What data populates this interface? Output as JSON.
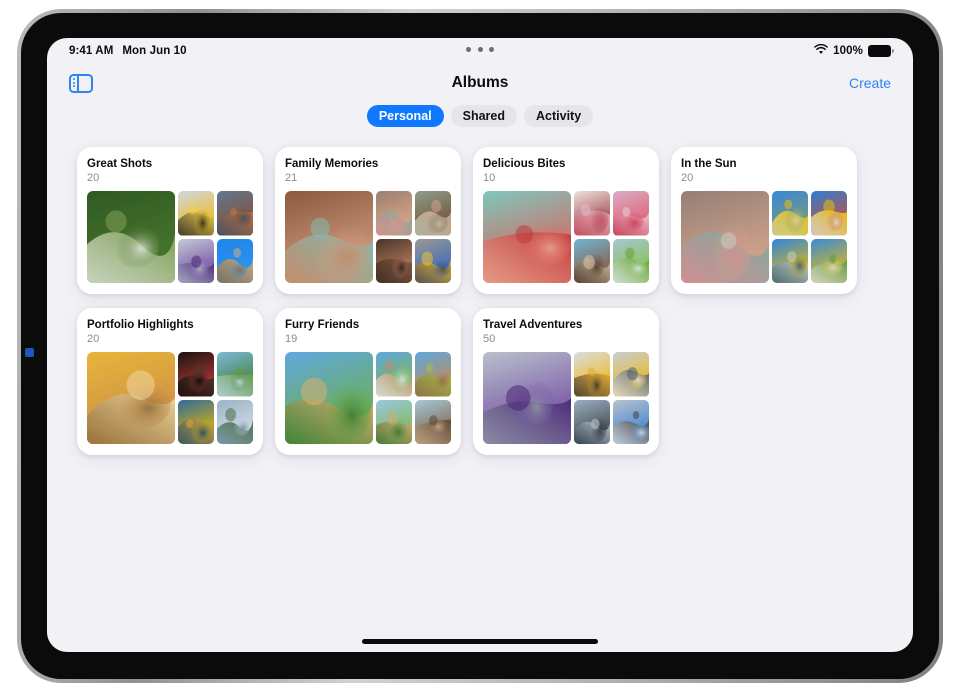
{
  "status_bar": {
    "time": "9:41 AM",
    "date": "Mon Jun 10",
    "battery_percent": "100%",
    "wifi_icon": "wifi-icon",
    "battery_icon": "battery-full-icon",
    "camera_dots_icon": "multitasking-dots-icon"
  },
  "nav_bar": {
    "sidebar_toggle_icon": "sidebar-toggle-icon",
    "title": "Albums",
    "create_label": "Create"
  },
  "tabs": [
    {
      "label": "Personal",
      "selected": true
    },
    {
      "label": "Shared",
      "selected": false
    },
    {
      "label": "Activity",
      "selected": false
    }
  ],
  "colors": {
    "accent_blue": "#2f83f7",
    "tab_selected_blue": "#1078ff",
    "screen_background": "#f2f1f6",
    "card_background": "#ffffff",
    "count_text": "#8a8a90"
  },
  "albums": [
    {
      "title": "Great Shots",
      "count": "20",
      "thumbnails": {
        "main": {
          "name": "woman-in-green-foliage-photo",
          "colors": [
            "#2f5a24",
            "#4d7a2e",
            "#86a65a",
            "#e8ece2"
          ]
        },
        "small": [
          {
            "name": "yellow-jacket-sneaker-photo",
            "colors": [
              "#cfd9e2",
              "#f2b705",
              "#f5d142",
              "#1b1b1b"
            ]
          },
          {
            "name": "basketball-player-court-photo",
            "colors": [
              "#5f7a91",
              "#8a4a2f",
              "#c9723c",
              "#3b4f63"
            ]
          },
          {
            "name": "purple-fabric-city-photo",
            "colors": [
              "#c3cbd6",
              "#6d3f9e",
              "#431f73",
              "#aab4c2"
            ]
          },
          {
            "name": "dog-jumping-blue-sky-photo",
            "colors": [
              "#1f84e8",
              "#2f97f5",
              "#d9b07a",
              "#8a6a45"
            ]
          }
        ]
      }
    },
    {
      "title": "Family Memories",
      "count": "21",
      "thumbnails": {
        "main": {
          "name": "family-group-selfie-photo",
          "colors": [
            "#8c5a3f",
            "#d9a488",
            "#7ec4b8",
            "#c98f6e"
          ]
        },
        "small": [
          {
            "name": "siblings-hugging-photo",
            "colors": [
              "#9b8070",
              "#e0a98a",
              "#7fae9e",
              "#d98f8f"
            ]
          },
          {
            "name": "father-and-child-photo",
            "colors": [
              "#8f9e8b",
              "#6e4a33",
              "#d4a58a",
              "#b9c4ae"
            ]
          },
          {
            "name": "family-on-couch-photo",
            "colors": [
              "#4a3328",
              "#d08f6e",
              "#8a5c44",
              "#2e2019"
            ]
          },
          {
            "name": "child-in-blue-sweater-photo",
            "colors": [
              "#9a9892",
              "#2f63c4",
              "#f0c92c",
              "#5a4636"
            ]
          }
        ]
      }
    },
    {
      "title": "Delicious Bites",
      "count": "10",
      "thumbnails": {
        "main": {
          "name": "watermelon-and-berries-photo",
          "colors": [
            "#7fc8be",
            "#e8544f",
            "#c42f33",
            "#f0a08a"
          ]
        },
        "small": [
          {
            "name": "layered-cake-slice-photo",
            "colors": [
              "#f0e2dc",
              "#8f2f3a",
              "#e4b8c2",
              "#c94a5a"
            ]
          },
          {
            "name": "pink-dessert-bowl-photo",
            "colors": [
              "#d9aec4",
              "#e0556a",
              "#f2cdd6",
              "#c23a52"
            ]
          },
          {
            "name": "tart-with-berries-photo",
            "colors": [
              "#6fb6d4",
              "#8a5236",
              "#d9c7a8",
              "#4d3322"
            ]
          },
          {
            "name": "green-popsicle-photo",
            "colors": [
              "#a8c6d4",
              "#7fc23a",
              "#5fa02a",
              "#e0e6e8"
            ]
          }
        ]
      }
    },
    {
      "title": "In the Sun",
      "count": "20",
      "thumbnails": {
        "main": {
          "name": "friends-huddle-looking-down-photo",
          "colors": [
            "#2f7fd4",
            "#f2c200",
            "#d9d2c2",
            "#4a3a2a"
          ]
        },
        "small": [
          {
            "name": "person-lying-on-yellow-photo",
            "colors": [
              "#3a8ad9",
              "#7f9a6e",
              "#f2c200",
              "#e8d98a"
            ]
          },
          {
            "name": "ball-toss-in-air-photo",
            "colors": [
              "#2f7fd4",
              "#d94a2f",
              "#f2c200",
              "#e8e2d4"
            ]
          },
          {
            "name": "people-under-blue-sky-photo",
            "colors": [
              "#2f84dd",
              "#f2c200",
              "#cfd4c2",
              "#3a5a7a"
            ]
          },
          {
            "name": "person-jumping-grass-photo",
            "colors": [
              "#3a8ad9",
              "#f2c200",
              "#5f9a3a",
              "#e0e0d4"
            ]
          }
        ]
      }
    },
    {
      "title": "Portfolio Highlights",
      "count": "20",
      "thumbnails": {
        "main": {
          "name": "woman-resting-on-bed-photo",
          "colors": [
            "#e8b53a",
            "#c98a4a",
            "#f0d9a8",
            "#8a6a3a"
          ]
        },
        "small": [
          {
            "name": "person-in-dark-doorway-photo",
            "colors": [
              "#1a1410",
              "#c43a3a",
              "#4a3a2a",
              "#0d0a08"
            ]
          },
          {
            "name": "palm-tree-tropical-photo",
            "colors": [
              "#7fb8d9",
              "#3a7a2a",
              "#5f9a3a",
              "#c8dce8"
            ]
          },
          {
            "name": "woman-in-yellow-dress-photo",
            "colors": [
              "#2f6a9a",
              "#f2c200",
              "#e8a82f",
              "#1a4a6a"
            ]
          },
          {
            "name": "mountain-and-clouds-photo",
            "colors": [
              "#9ab4c8",
              "#d9e2e8",
              "#4a6a3a",
              "#6a8a9a"
            ]
          }
        ]
      }
    },
    {
      "title": "Furry Friends",
      "count": "19",
      "thumbnails": {
        "main": {
          "name": "golden-retriever-running-photo",
          "colors": [
            "#5fa8e0",
            "#6fb03a",
            "#e0b06a",
            "#3a7a2a"
          ]
        },
        "small": [
          {
            "name": "dog-with-owner-grass-photo",
            "colors": [
              "#5fa8e0",
              "#7fb84a",
              "#c98a5a",
              "#e8e8e0"
            ]
          },
          {
            "name": "dog-howling-photo",
            "colors": [
              "#5fa8e0",
              "#c98a4a",
              "#a8c23a",
              "#8a6a3a"
            ]
          },
          {
            "name": "puppy-sitting-field-photo",
            "colors": [
              "#9ac8e0",
              "#7fb84a",
              "#d9a86a",
              "#3a6a2a"
            ]
          },
          {
            "name": "horse-closeup-photo",
            "colors": [
              "#a8c8d9",
              "#7a5a3a",
              "#5a4030",
              "#c9a882"
            ]
          }
        ]
      }
    },
    {
      "title": "Travel Adventures",
      "count": "50",
      "thumbnails": {
        "main": {
          "name": "skyscrapers-looking-up-photo",
          "colors": [
            "#b8c2cc",
            "#6d3f9e",
            "#431f73",
            "#8a94a0"
          ]
        },
        "small": [
          {
            "name": "yellow-raincoat-person-photo",
            "colors": [
              "#d9dde2",
              "#f2b705",
              "#e8a82f",
              "#2a2a2a"
            ]
          },
          {
            "name": "yellow-jacket-train-photo",
            "colors": [
              "#c8cdd4",
              "#f2b705",
              "#4a5a6a",
              "#e8e2d4"
            ]
          },
          {
            "name": "traffic-light-sky-photo",
            "colors": [
              "#9ab0c4",
              "#3a3a3a",
              "#c2ccd6",
              "#2a3a4a"
            ]
          },
          {
            "name": "people-on-blue-floor-photo",
            "colors": [
              "#b8c2cc",
              "#2f7fd4",
              "#3a3a3a",
              "#d9dde2"
            ]
          }
        ]
      }
    }
  ],
  "home_indicator": "home-indicator"
}
